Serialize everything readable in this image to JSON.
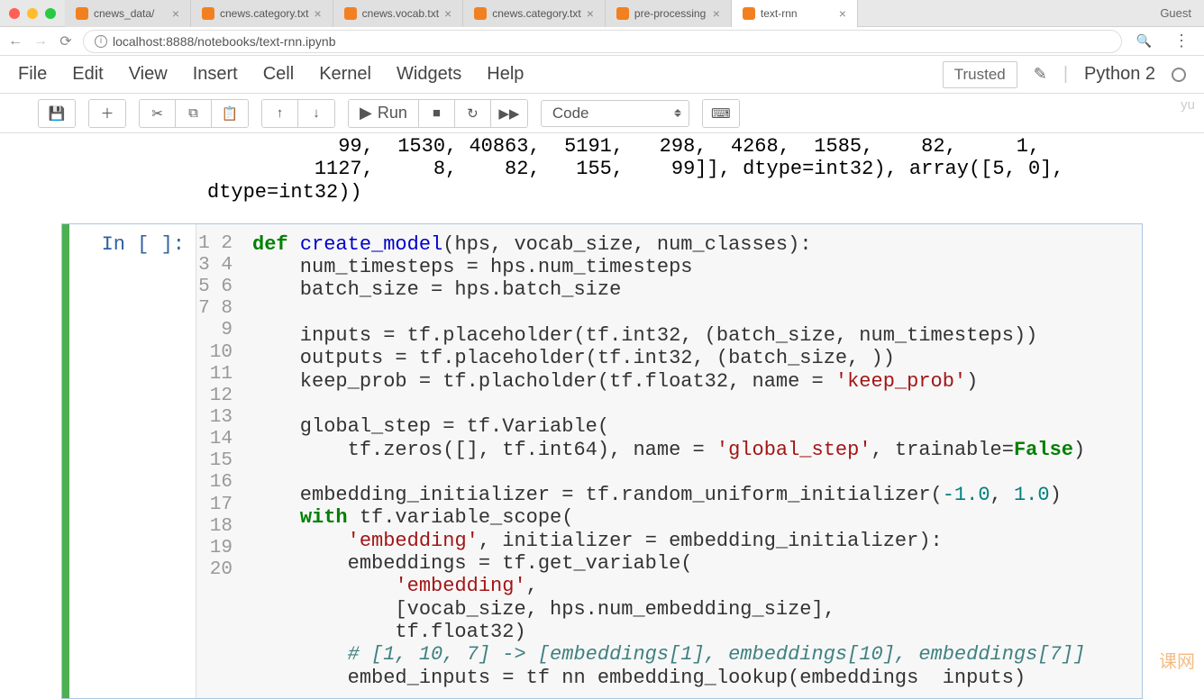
{
  "browser": {
    "tabs": [
      {
        "label": "cnews_data/",
        "active": false
      },
      {
        "label": "cnews.category.txt",
        "active": false
      },
      {
        "label": "cnews.vocab.txt",
        "active": false
      },
      {
        "label": "cnews.category.txt",
        "active": false
      },
      {
        "label": "pre-processing",
        "active": false
      },
      {
        "label": "text-rnn",
        "active": true
      }
    ],
    "guest": "Guest",
    "url": "localhost:8888/notebooks/text-rnn.ipynb"
  },
  "jupyter": {
    "menus": [
      "File",
      "Edit",
      "View",
      "Insert",
      "Cell",
      "Kernel",
      "Widgets",
      "Help"
    ],
    "trusted": "Trusted",
    "kernel": "Python 2",
    "run_label": "Run",
    "cell_type": "Code",
    "yu": "yu"
  },
  "output": {
    "line1": "           99,  1530, 40863,  5191,   298,  4268,  1585,    82,     1,",
    "line2": "         1127,     8,    82,   155,    99]], dtype=int32), array([5, 0],",
    "line3": "dtype=int32))"
  },
  "code": {
    "prompt": "In [ ]:",
    "line_numbers": [
      "1",
      "2",
      "3",
      "4",
      "5",
      "6",
      "7",
      "8",
      "9",
      "10",
      "11",
      "12",
      "13",
      "14",
      "15",
      "16",
      "17",
      "18",
      "19",
      "20"
    ],
    "tokens": {
      "l1_def": "def",
      "l1_fn": "create_model",
      "l1_rest": "(hps, vocab_size, num_classes):",
      "l2": "    num_timesteps = hps.num_timesteps",
      "l3": "    batch_size = hps.batch_size",
      "l5": "    inputs = tf.placeholder(tf.int32, (batch_size, num_timesteps))",
      "l6": "    outputs = tf.placeholder(tf.int32, (batch_size, ))",
      "l7a": "    keep_prob = tf.placholder(tf.float32, name = ",
      "l7s": "'keep_prob'",
      "l7b": ")",
      "l9": "    global_step = tf.Variable(",
      "l10a": "        tf.zeros([], tf.int64), name = ",
      "l10s": "'global_step'",
      "l10b": ", trainable=",
      "l10f": "False",
      "l10c": ")",
      "l12a": "    embedding_initializer = tf.random_uniform_initializer(",
      "l12n1": "-1.0",
      "l12c": ", ",
      "l12n2": "1.0",
      "l12b": ")",
      "l13a": "    ",
      "l13w": "with",
      "l13b": " tf.variable_scope(",
      "l14a": "        ",
      "l14s": "'embedding'",
      "l14b": ", initializer = embedding_initializer):",
      "l15": "        embeddings = tf.get_variable(",
      "l16a": "            ",
      "l16s": "'embedding'",
      "l16b": ",",
      "l17": "            [vocab_size, hps.num_embedding_size],",
      "l18": "            tf.float32)",
      "l19a": "        ",
      "l19c": "# [1, 10, 7] -> [embeddings[1], embeddings[10], embeddings[7]]",
      "l20": "        embed_inputs = tf nn embedding_lookup(embeddings  inputs)"
    }
  },
  "watermark": "课网"
}
